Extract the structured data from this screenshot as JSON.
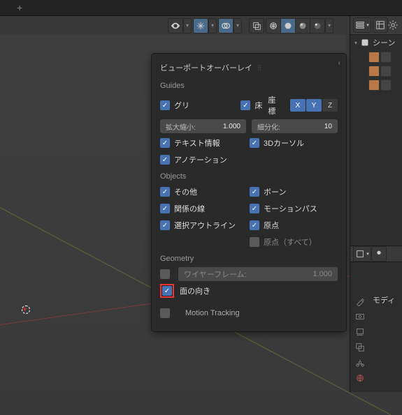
{
  "topbar": {
    "plus": "+"
  },
  "popover": {
    "title": "ビューポートオーバーレイ",
    "guides_label": "Guides",
    "grid": "グリ",
    "floor": "床",
    "axes_label": "座標",
    "axis_x": "X",
    "axis_y": "Y",
    "axis_z": "Z",
    "scale_label": "拡大縮小:",
    "scale_val": "1.000",
    "subdiv_label": "細分化:",
    "subdiv_val": "10",
    "text_info": "テキスト情報",
    "cursor3d": "3Dカーソル",
    "annotations": "アノテーション",
    "objects_label": "Objects",
    "extras": "その他",
    "bones": "ボーン",
    "relationship": "関係の線",
    "motion_paths": "モーションパス",
    "outline_selected": "選択アウトライン",
    "origins": "原点",
    "origins_all": "原点（すべて）",
    "geometry_label": "Geometry",
    "wireframe": "ワイヤーフレーム:",
    "wireframe_val": "1.000",
    "face_orientation": "面の向き",
    "motion_tracking": "Motion Tracking"
  },
  "outliner": {
    "scene": "シーン"
  },
  "props": {
    "modifier": "モディ"
  }
}
